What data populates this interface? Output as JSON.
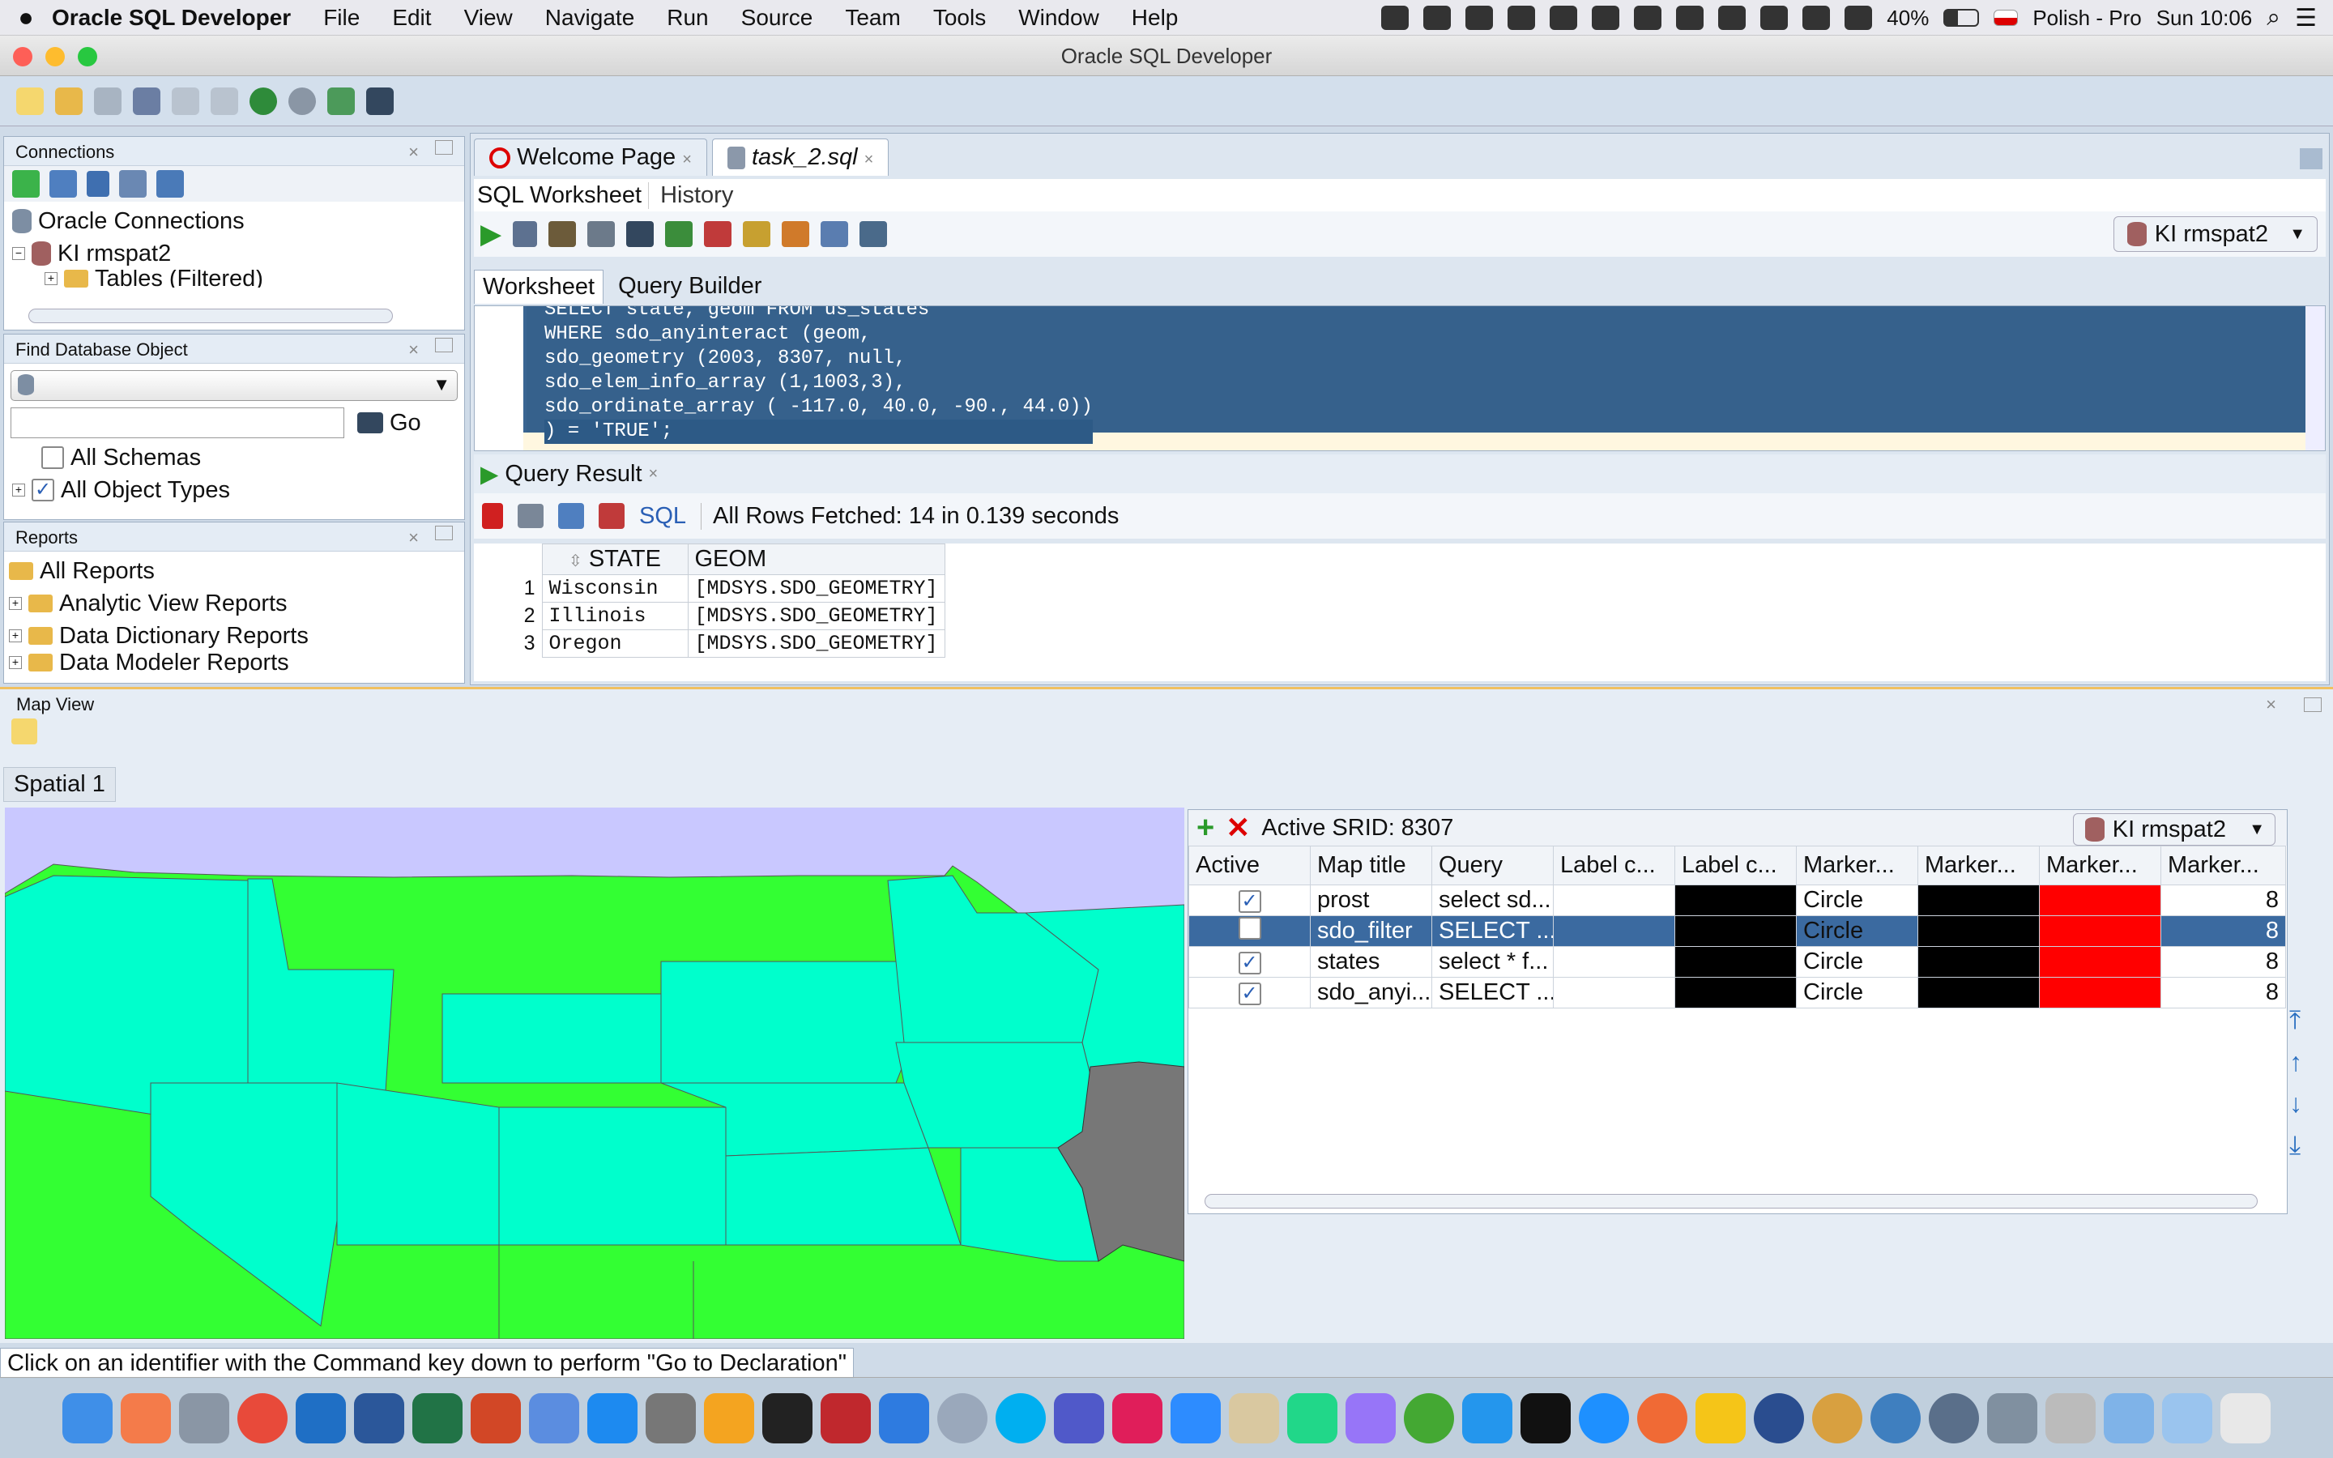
{
  "menubar": {
    "app_name": "Oracle SQL Developer",
    "items": [
      "File",
      "Edit",
      "View",
      "Navigate",
      "Run",
      "Source",
      "Team",
      "Tools",
      "Window",
      "Help"
    ],
    "battery": "40%",
    "input_source": "Polish - Pro",
    "clock": "Sun 10:06"
  },
  "window": {
    "title": "Oracle SQL Developer"
  },
  "connections": {
    "header": "Connections",
    "items": [
      "Oracle Connections",
      "KI rmspat2",
      "Tables (Filtered)"
    ]
  },
  "find_db": {
    "header": "Find Database Object",
    "go_label": "Go",
    "search_value": "",
    "options": [
      "All Schemas",
      "All Object Types"
    ]
  },
  "reports": {
    "header": "Reports",
    "items": [
      "All Reports",
      "Analytic View Reports",
      "Data Dictionary Reports",
      "Data Modeler Reports"
    ]
  },
  "editor": {
    "tabs": [
      "Welcome Page",
      "task_2.sql"
    ],
    "subtabs": [
      "SQL Worksheet",
      "History"
    ],
    "connection": "KI rmspat2",
    "inner_tabs": [
      "Worksheet",
      "Query Builder"
    ],
    "code": [
      "SELECT state, geom FROM us_states",
      "WHERE sdo_anyinteract (geom,",
      "sdo_geometry (2003, 8307, null,",
      "sdo_elem_info_array (1,1003,3),",
      "sdo_ordinate_array ( -117.0, 40.0, -90., 44.0))",
      ") = 'TRUE';"
    ]
  },
  "query_result": {
    "tab": "Query Result",
    "sql_label": "SQL",
    "status": "All Rows Fetched: 14 in 0.139 seconds",
    "columns": [
      "STATE",
      "GEOM"
    ],
    "rows": [
      {
        "n": "1",
        "state": "Wisconsin",
        "geom": "[MDSYS.SDO_GEOMETRY]"
      },
      {
        "n": "2",
        "state": "Illinois",
        "geom": "[MDSYS.SDO_GEOMETRY]"
      },
      {
        "n": "3",
        "state": "Oregon",
        "geom": "[MDSYS.SDO_GEOMETRY]"
      }
    ]
  },
  "map_view": {
    "header": "Map View",
    "tab": "Spatial 1",
    "srid_label": "Active SRID: 8307",
    "connection": "KI rmspat2",
    "columns": [
      "Active",
      "Map title",
      "Query",
      "Label c...",
      "Label c...",
      "Marker...",
      "Marker...",
      "Marker...",
      "Marker..."
    ],
    "layers": [
      {
        "active": "✓",
        "title": "prost",
        "query": "select sd...",
        "marker": "Circle",
        "size": "8"
      },
      {
        "active": "",
        "title": "sdo_filter",
        "query": "SELECT ...",
        "marker": "Circle",
        "size": "8"
      },
      {
        "active": "✓",
        "title": "states",
        "query": "select * f...",
        "marker": "Circle",
        "size": "8"
      },
      {
        "active": "✓",
        "title": "sdo_anyi...",
        "query": "SELECT ...",
        "marker": "Circle",
        "size": "8"
      }
    ],
    "colors": {
      "green": "#33ff33",
      "cyan": "#00ffcc",
      "gray": "#777777",
      "sea": "#c9c8ff"
    }
  },
  "statusbar": {
    "text": "Click on an identifier with the Command key down to perform \"Go to Declaration\""
  }
}
